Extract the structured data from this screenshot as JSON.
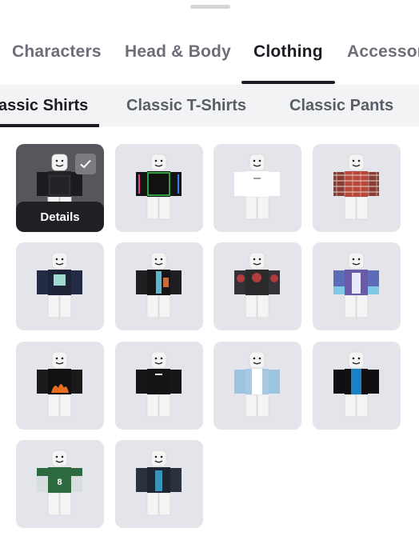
{
  "main_tabs": [
    {
      "label": "Characters",
      "active": false
    },
    {
      "label": "Head & Body",
      "active": false
    },
    {
      "label": "Clothing",
      "active": true
    },
    {
      "label": "Accessories",
      "active": false
    }
  ],
  "sub_tabs": [
    {
      "label": "Classic Shirts",
      "active": true
    },
    {
      "label": "Classic T-Shirts",
      "active": false
    },
    {
      "label": "Classic Pants",
      "active": false
    }
  ],
  "selected_item": {
    "details_label": "Details",
    "index": 0
  },
  "icons": {
    "selected": "checkmark-icon"
  },
  "items": [
    {
      "torso": "#222326",
      "sleeve": "#1b1c1f",
      "accent": "#3a3b40",
      "style": "dark"
    },
    {
      "torso": "#111111",
      "sleeve": "#151515",
      "accent": "#39d353",
      "style": "rainbow"
    },
    {
      "torso": "#ffffff",
      "sleeve": "#ffffff",
      "accent": "#9aa0b0",
      "style": "white"
    },
    {
      "torso": "#b7483a",
      "sleeve": "#8a3b33",
      "accent": "#f2ece6",
      "style": "plaid"
    },
    {
      "torso": "#1d2438",
      "sleeve": "#232b45",
      "accent": "#9fdad0",
      "style": "print"
    },
    {
      "torso": "#141516",
      "sleeve": "#1e1f21",
      "accent": "#c76b3c",
      "style": "jacket"
    },
    {
      "torso": "#2b2b2e",
      "sleeve": "#333337",
      "accent": "#b03c3c",
      "style": "pattern"
    },
    {
      "torso": "#6a5aa8",
      "sleeve": "#5d6cb8",
      "accent": "#e8e8ff",
      "style": "purple"
    },
    {
      "torso": "#111112",
      "sleeve": "#1a1a1b",
      "accent": "#e66d21",
      "style": "flame"
    },
    {
      "torso": "#141416",
      "sleeve": "#161618",
      "accent": "#ffffff",
      "style": "black"
    },
    {
      "torso": "#ffffff",
      "sleeve": "#9cc3df",
      "accent": "#a7c8e0",
      "style": "denim"
    },
    {
      "torso": "#1a82c4",
      "sleeve": "#101012",
      "accent": "#101012",
      "style": "blueblack"
    },
    {
      "torso": "#2e6a40",
      "sleeve": "#d9dde0",
      "accent": "#ffffff",
      "style": "jersey"
    },
    {
      "torso": "#1f2630",
      "sleeve": "#2a3240",
      "accent": "#3a93b8",
      "style": "leather"
    }
  ]
}
